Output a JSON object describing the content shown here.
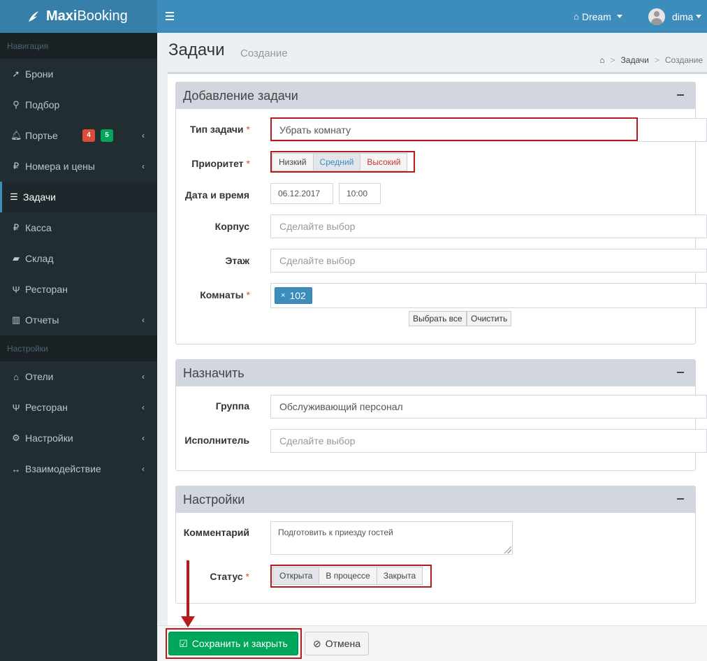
{
  "app": {
    "logo_bold": "Maxi",
    "logo_rest": "Booking"
  },
  "topbar": {
    "hotel": "Dream",
    "user": "dima"
  },
  "sidebar": {
    "nav_header": "Навигация",
    "settings_header": "Настройки",
    "items": [
      {
        "label": "Брони",
        "icon": "paper-plane-icon"
      },
      {
        "label": "Подбор",
        "icon": "search-icon"
      },
      {
        "label": "Портье",
        "icon": "bell-icon",
        "badges": [
          "4",
          "5"
        ]
      },
      {
        "label": "Номера и цены",
        "icon": "ruble-icon"
      },
      {
        "label": "Задачи",
        "icon": "tasks-icon",
        "active": true
      },
      {
        "label": "Касса",
        "icon": "ruble-icon"
      },
      {
        "label": "Склад",
        "icon": "book-icon"
      },
      {
        "label": "Ресторан",
        "icon": "cutlery-icon"
      },
      {
        "label": "Отчеты",
        "icon": "bar-chart-icon"
      }
    ],
    "settings_items": [
      {
        "label": "Отели",
        "icon": "home-icon"
      },
      {
        "label": "Ресторан",
        "icon": "cutlery-icon"
      },
      {
        "label": "Настройки",
        "icon": "gears-icon"
      },
      {
        "label": "Взаимодействие",
        "icon": "arrows-h-icon"
      }
    ]
  },
  "page": {
    "title": "Задачи",
    "subtitle": "Создание"
  },
  "breadcrumb": {
    "section": "Задачи",
    "current": "Создание"
  },
  "add_task": {
    "title": "Добавление задачи",
    "type_label": "Тип задачи",
    "type_value": "Убрать комнату",
    "priority_label": "Приоритет",
    "priority_options": [
      "Низкий",
      "Средний",
      "Высокий"
    ],
    "priority_selected": "Средний",
    "datetime_label": "Дата и время",
    "date_value": "06.12.2017",
    "time_value": "10:00",
    "building_label": "Корпус",
    "building_placeholder": "Сделайте выбор",
    "floor_label": "Этаж",
    "floor_placeholder": "Сделайте выбор",
    "rooms_label": "Комнаты",
    "rooms_tags": [
      "102"
    ],
    "select_all": "Выбрать все",
    "clear": "Очистить"
  },
  "assign": {
    "title": "Назначить",
    "group_label": "Группа",
    "group_value": "Обслуживающий персонал",
    "performer_label": "Исполнитель",
    "performer_placeholder": "Сделайте выбор"
  },
  "settings": {
    "title": "Настройки",
    "comment_label": "Комментарий",
    "comment_value": "Подготовить к приезду гостей",
    "status_label": "Статус",
    "status_options": [
      "Открыта",
      "В процессе",
      "Закрыта"
    ],
    "status_selected": "Открыта"
  },
  "footer": {
    "save": "Сохранить и закрыть",
    "cancel": "Отмена"
  },
  "colors": {
    "header": "#3c8dbc",
    "sidebar": "#222d32",
    "save": "#00a65a",
    "highlight": "#b71c1c"
  }
}
